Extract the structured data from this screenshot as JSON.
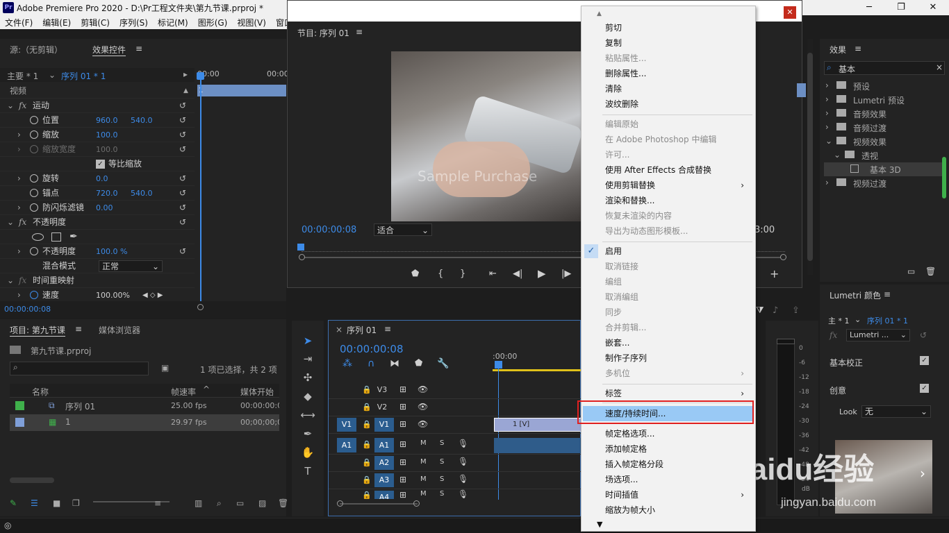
{
  "window": {
    "title": "Adobe Premiere Pro 2020 - D:\\Pr工程文件夹\\第九节课.prproj *",
    "logo": "Pr"
  },
  "menubar": [
    "文件(F)",
    "编辑(E)",
    "剪辑(C)",
    "序列(S)",
    "标记(M)",
    "图形(G)",
    "视图(V)",
    "窗口"
  ],
  "effect_controls": {
    "tab_source": "源:（无剪辑）",
    "tab_effect": "效果控件",
    "master": "主要 * 1",
    "sequence": "序列 01 * 1",
    "ruler_start": "00:00",
    "ruler_mid": "00:00",
    "clip_label": "1",
    "section_video": "视频",
    "motion": "运动",
    "position": {
      "label": "位置",
      "x": "960.0",
      "y": "540.0"
    },
    "scale": {
      "label": "缩放",
      "value": "100.0"
    },
    "scale_width": {
      "label": "缩放宽度",
      "value": "100.0"
    },
    "uniform_scale": "等比缩放",
    "rotation": {
      "label": "旋转",
      "value": "0.0"
    },
    "anchor": {
      "label": "锚点",
      "x": "720.0",
      "y": "540.0"
    },
    "flicker": {
      "label": "防闪烁滤镜",
      "value": "0.00"
    },
    "opacity_section": "不透明度",
    "opacity": {
      "label": "不透明度",
      "value": "100.0 %"
    },
    "blend": {
      "label": "混合模式",
      "value": "正常"
    },
    "time_remap": "时间重映射",
    "speed": {
      "label": "速度",
      "value": "100.00%"
    },
    "timecode": "00:00:00:08"
  },
  "program_monitor": {
    "title": "节目: 序列 01",
    "timecode": "00:00:00:08",
    "fit": "适合",
    "end_time": "3:00",
    "watermark": "Sample Purchase"
  },
  "project": {
    "tab_project": "项目: 第九节课",
    "tab_browser": "媒体浏览器",
    "file": "第九节课.prproj",
    "selection": "1 项已选择，共 2 项",
    "columns": [
      "名称",
      "帧速率",
      "媒体开始"
    ],
    "rows": [
      {
        "name": "序列 01",
        "fps": "25.00 fps",
        "start": "00:00:00:00",
        "color": "#3fb04b"
      },
      {
        "name": "1",
        "fps": "29.97 fps",
        "start": "00;00;00;00",
        "color": "#7f9fd8"
      }
    ]
  },
  "timeline": {
    "tab": "序列 01",
    "timecode": "00:00:00:08",
    "ruler": ":00:00",
    "video_tracks": [
      "V3",
      "V2",
      "V1"
    ],
    "audio_tracks": [
      "A1",
      "A2",
      "A3",
      "A4"
    ],
    "src_v": "V1",
    "src_a": "A1",
    "clip_v": "1 [V]",
    "m": "M",
    "s": "S"
  },
  "effects_panel": {
    "title": "效果",
    "search": "基本",
    "tree": [
      {
        "label": "预设",
        "level": 0
      },
      {
        "label": "Lumetri 预设",
        "level": 0
      },
      {
        "label": "音频效果",
        "level": 0
      },
      {
        "label": "音频过渡",
        "level": 0
      },
      {
        "label": "视频效果",
        "level": 0
      },
      {
        "label": "透视",
        "level": 1
      },
      {
        "label": "基本 3D",
        "level": 2
      },
      {
        "label": "视频过渡",
        "level": 0
      }
    ]
  },
  "lumetri": {
    "title": "Lumetri 颜色",
    "master": "主 * 1",
    "sequence": "序列 01 * 1",
    "preset": "Lumetri ...",
    "basic": "基本校正",
    "creative": "创意",
    "look_label": "Look",
    "look_value": "无"
  },
  "meter": {
    "ticks": [
      "0",
      "-6",
      "-12",
      "-18",
      "-24",
      "-30",
      "-36",
      "-42",
      "-48",
      "-54"
    ],
    "unit": "dB"
  },
  "context_menu": {
    "items": [
      {
        "label": "剪切",
        "enabled": true
      },
      {
        "label": "复制",
        "enabled": true
      },
      {
        "label": "粘贴属性...",
        "enabled": false
      },
      {
        "label": "删除属性...",
        "enabled": true
      },
      {
        "label": "清除",
        "enabled": true
      },
      {
        "label": "波纹删除",
        "enabled": true
      },
      {
        "label": "编辑原始",
        "enabled": false
      },
      {
        "label": "在 Adobe Photoshop 中编辑",
        "enabled": false
      },
      {
        "label": "许可...",
        "enabled": false
      },
      {
        "label": "使用 After Effects 合成替换",
        "enabled": true
      },
      {
        "label": "使用剪辑替换",
        "enabled": true
      },
      {
        "label": "渲染和替换...",
        "enabled": true
      },
      {
        "label": "恢复未渲染的内容",
        "enabled": false
      },
      {
        "label": "导出为动态图形模板...",
        "enabled": false
      },
      {
        "label": "启用",
        "enabled": true
      },
      {
        "label": "取消链接",
        "enabled": false
      },
      {
        "label": "编组",
        "enabled": false
      },
      {
        "label": "取消编组",
        "enabled": false
      },
      {
        "label": "同步",
        "enabled": false
      },
      {
        "label": "合并剪辑...",
        "enabled": false
      },
      {
        "label": "嵌套...",
        "enabled": true
      },
      {
        "label": "制作子序列",
        "enabled": true
      },
      {
        "label": "多机位",
        "enabled": false
      },
      {
        "label": "标签",
        "enabled": true
      },
      {
        "label": "速度/持续时间...",
        "enabled": true
      },
      {
        "label": "帧定格选项...",
        "enabled": true
      },
      {
        "label": "添加帧定格",
        "enabled": true
      },
      {
        "label": "插入帧定格分段",
        "enabled": true
      },
      {
        "label": "场选项...",
        "enabled": true
      },
      {
        "label": "时间插值",
        "enabled": true
      },
      {
        "label": "缩放为帧大小",
        "enabled": true
      }
    ]
  },
  "watermark": {
    "text": "Baidu经验",
    "url": "jingyan.baidu.com"
  }
}
